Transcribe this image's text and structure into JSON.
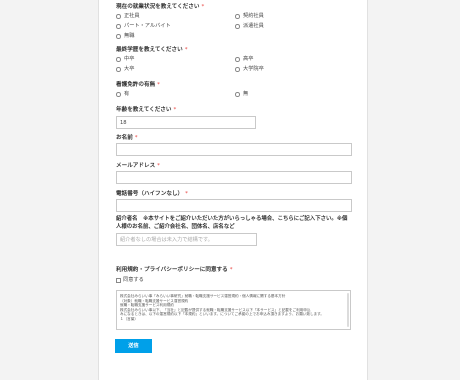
{
  "employment": {
    "label": "現在の就業状況を教えてください",
    "required_mark": "*",
    "options": [
      "正社員",
      "契約社員",
      "パート・アルバイト",
      "派遣社員",
      "無職"
    ]
  },
  "education": {
    "label": "最終学歴を教えてください",
    "required_mark": "*",
    "options": [
      "中卒",
      "高卒",
      "大卒",
      "大学院卒"
    ]
  },
  "nursing_license": {
    "label": "看護免許の有無",
    "required_mark": "*",
    "options": [
      "有",
      "無"
    ]
  },
  "age": {
    "label": "年齢を教えてください",
    "required_mark": "*",
    "value": "18"
  },
  "name": {
    "label": "お名前",
    "required_mark": "*",
    "value": ""
  },
  "email": {
    "label": "メールアドレス",
    "required_mark": "*",
    "value": ""
  },
  "phone": {
    "label": "電話番号（ハイフンなし）",
    "required_mark": "*",
    "value": ""
  },
  "referral": {
    "note": "紹介者名　※本サイトをご紹介いただいた方がいらっしゃる場合、こちらにご記入下さい。※個人様のお名前、ご紹介会社名、団体名、店名など",
    "placeholder": "紹介者なしの場合は未入力で結構です。"
  },
  "consent": {
    "label": "利用規約・プライバシーポリシーに同意する",
    "required_mark": "*",
    "checkbox_label": "同意する"
  },
  "terms_text": [
    "株式会社みらいい事「みらいい事研究」就職・転職支援サービス運営規約・個人情報に関する基本方針",
    "（対象）就職・転職支援サービス運営規約",
    "就職・転職支援サービス利用規約",
    "株式会社みらいい事以下、「当社」と記載が提供する就職・転職支援サービス以下「本サービス」と記載をご利用申込",
    "みになるときは、以下の運営規約以下「本規約」といいます。についてご承諾の上でお申込み頂きますよう、お願い致します。",
    "１（言葉）"
  ],
  "submit_label": "送信"
}
